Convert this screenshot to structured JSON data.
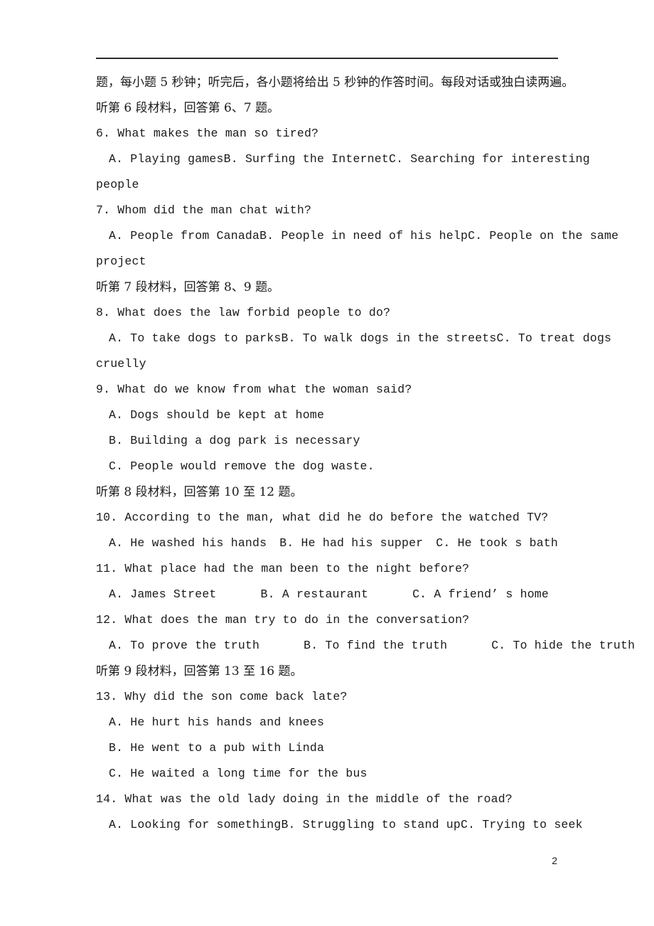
{
  "page": {
    "page_number": "2",
    "rule_color": "#2b2b2b",
    "text_color": "#1a1a1a",
    "background": "#ffffff"
  },
  "lines": {
    "instruction_continuation": "题，每小题 5 秒钟；听完后，各小题将给出 5 秒钟的作答时间。每段对话或独白读两遍。",
    "section_6_7": "听第 6 段材料，回答第 6、7 题。",
    "section_8_9": "听第 7 段材料，回答第 8、9 题。",
    "section_10_12": "听第 8 段材料，回答第 10 至 12 题。",
    "section_13_16": "听第 9 段材料，回答第 13 至 16 题。"
  },
  "questions": [
    {
      "id": "q6",
      "stem": "6. What makes the man so tired?",
      "options_inline": [
        "A. Playing games",
        "B. Surfing the Internet",
        "C. Searching for interesting"
      ],
      "wrap": "people"
    },
    {
      "id": "q7",
      "stem": "7. Whom did the man chat with?",
      "options_inline": [
        "A. People from Canada",
        "B. People in need of his help",
        "C. People on the same"
      ],
      "wrap": "project"
    },
    {
      "id": "q8",
      "stem": "8. What does the law forbid people to do?",
      "options_inline": [
        "A. To take dogs to parks",
        "B. To walk dogs in the streets",
        "C. To treat dogs"
      ],
      "wrap": "cruelly"
    },
    {
      "id": "q9",
      "stem": "9. What do we know from what the woman said?",
      "options_stacked": [
        "A. Dogs should be kept at home",
        "B. Building a dog park is necessary",
        "C. People would remove the dog waste."
      ]
    },
    {
      "id": "q10",
      "stem": "10. According to the man, what did he do before the watched TV?",
      "options_inline": [
        "A. He washed his hands",
        "B. He had his supper",
        "C. He took s bath"
      ]
    },
    {
      "id": "q11",
      "stem": "11. What place had the man been to the night before?",
      "options_inline": [
        "A. James Street",
        "B. A restaurant",
        "C. A friend’ s home"
      ]
    },
    {
      "id": "q12",
      "stem": "12. What does the man try to do in the conversation?",
      "options_inline": [
        "A. To prove the truth",
        "B. To find the truth",
        "C. To hide the truth"
      ]
    },
    {
      "id": "q13",
      "stem": "13. Why did the son come back late?",
      "options_stacked": [
        "A. He hurt his hands and knees",
        "B. He went to a pub with Linda",
        "C. He waited a long time for the bus"
      ]
    },
    {
      "id": "q14",
      "stem": "14. What was the old lady doing in the middle of the road?",
      "options_inline": [
        "A. Looking for something",
        "B. Struggling to stand up",
        "C. Trying to seek"
      ]
    }
  ]
}
